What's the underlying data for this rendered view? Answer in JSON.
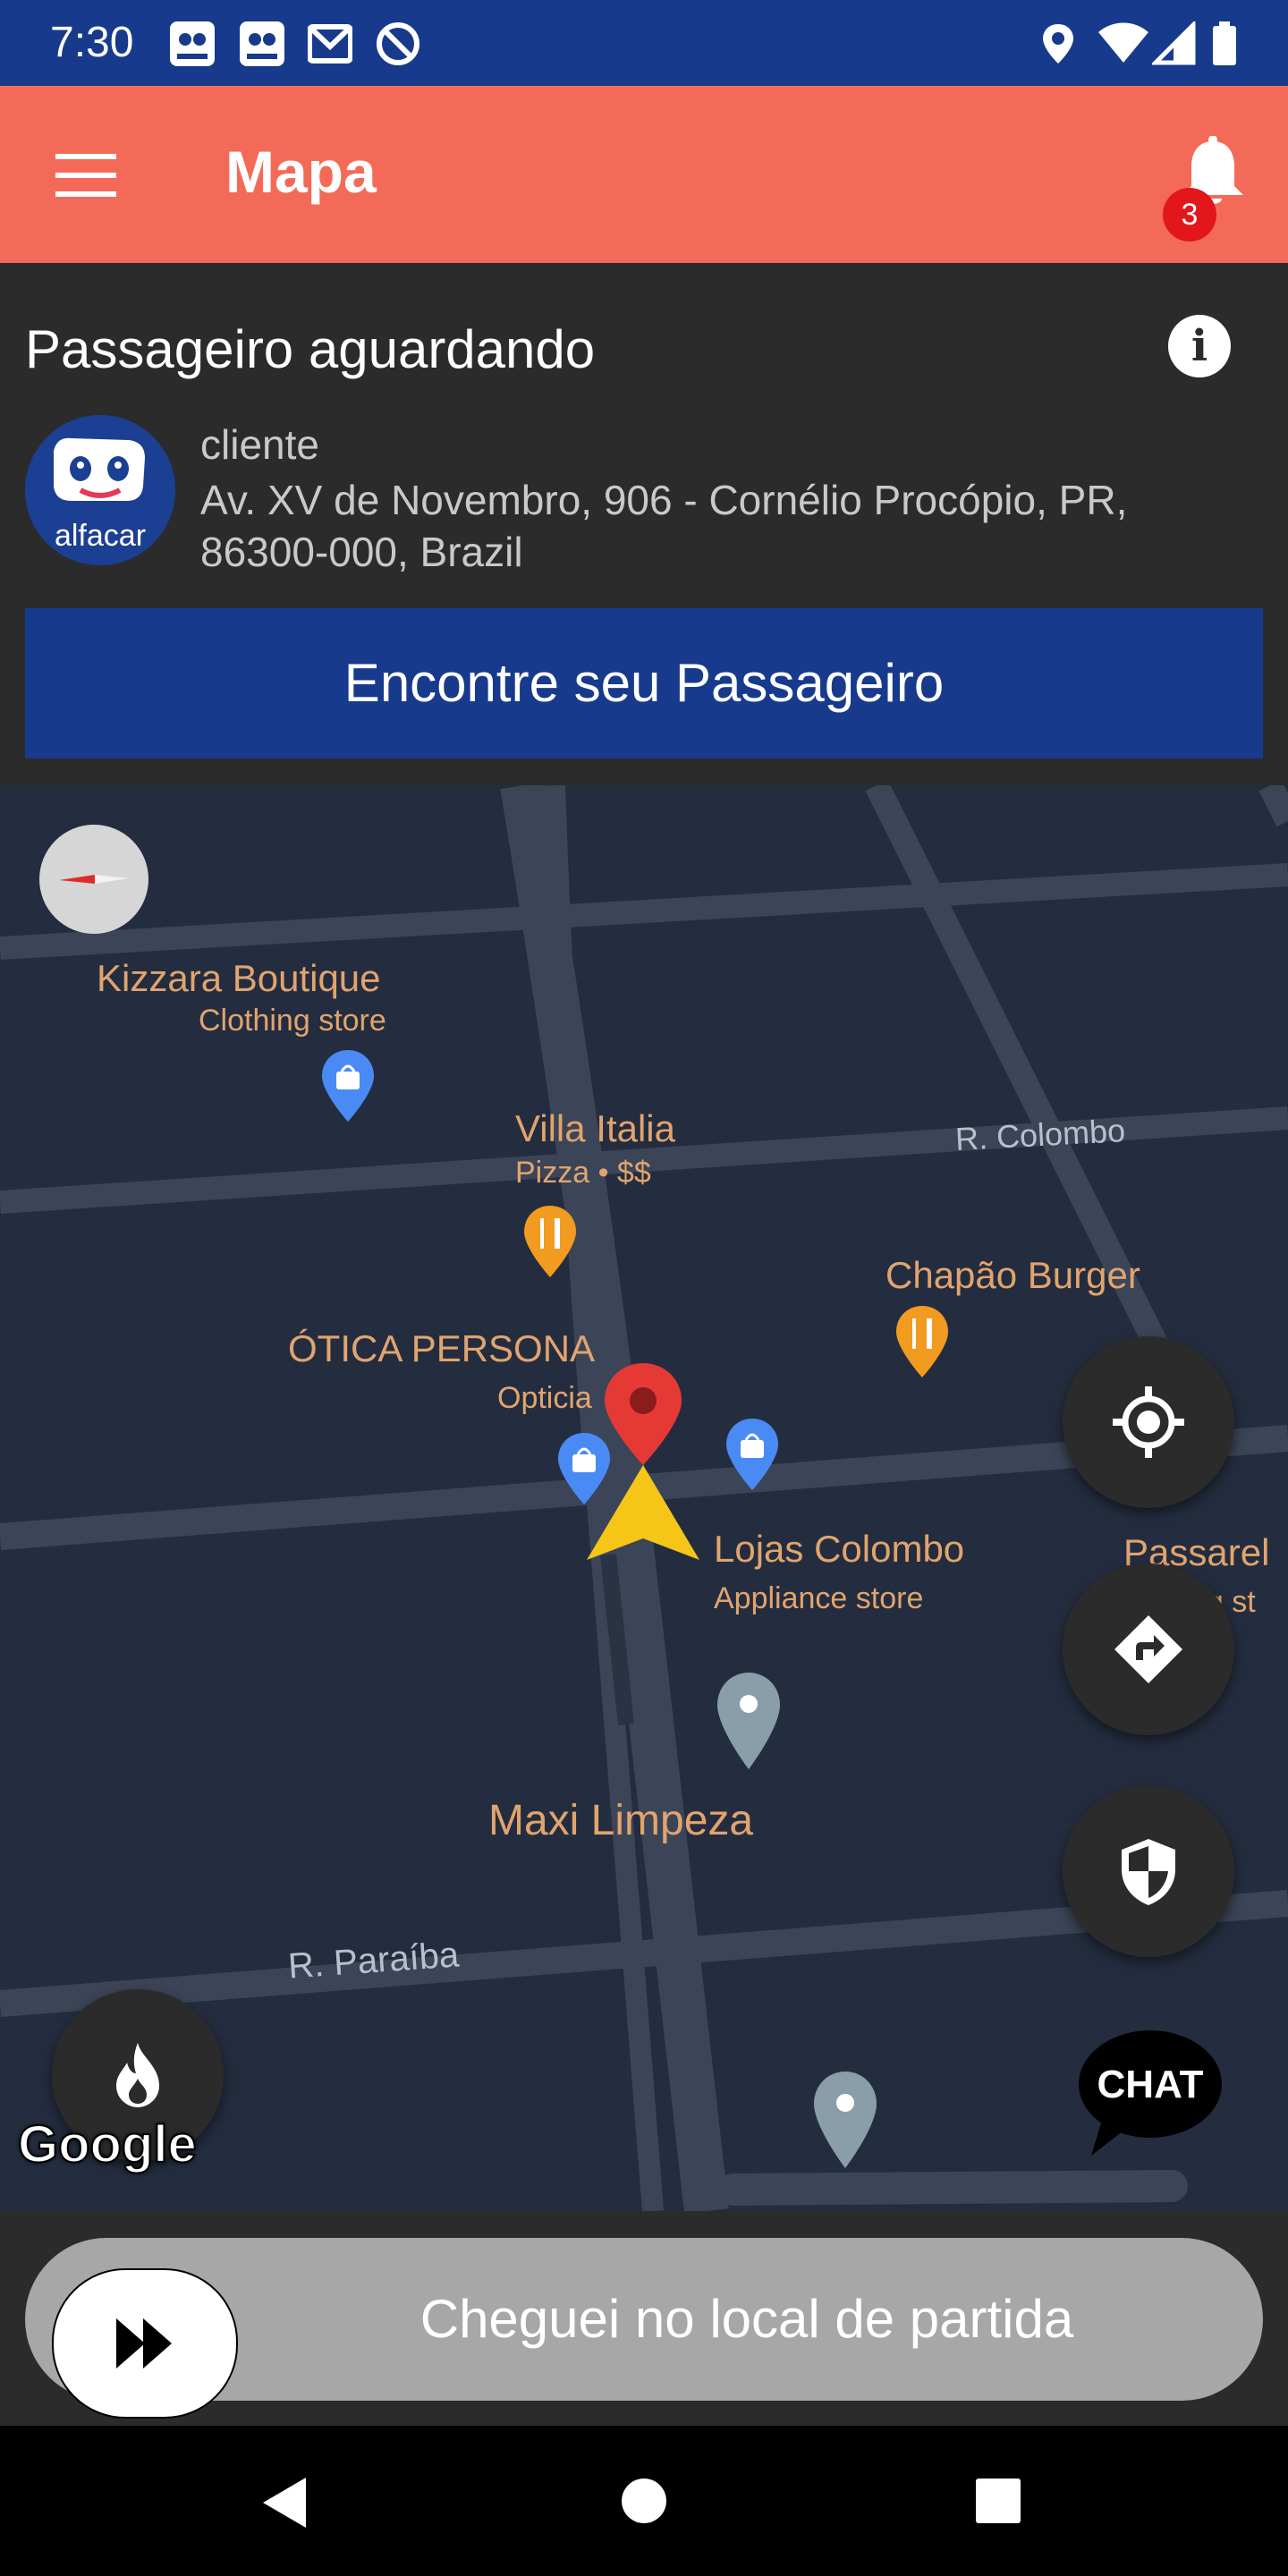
{
  "status_bar": {
    "time": "7:30",
    "icons": [
      "alfacar-notification-icon",
      "alfacar-notification-icon",
      "gmail-icon",
      "do-not-disturb-icon",
      "location-icon",
      "wifi-icon",
      "signal-icon",
      "battery-icon"
    ],
    "notif_label": "alfacar"
  },
  "app_bar": {
    "title": "Mapa",
    "notification_count": "3"
  },
  "passenger_panel": {
    "heading": "Passageiro aguardando",
    "info_icon": "i",
    "client_name": "cliente",
    "address": "Av. XV de Novembro, 906 - Cornélio Procópio, PR, 86300-000, Brazil",
    "avatar_text": "alfacar",
    "find_button": "Encontre seu Passageiro"
  },
  "map": {
    "places": [
      {
        "name": "Kizzara Boutique",
        "category": "Clothing store"
      },
      {
        "name": "Villa Italia",
        "category": "Pizza • $$"
      },
      {
        "name": "Chapão Burger",
        "category": ""
      },
      {
        "name": "ÓTICA PERSONA",
        "category": "Opticia"
      },
      {
        "name": "Lojas Colombo",
        "category": "Appliance store"
      },
      {
        "name": "Passarel",
        "category": "ng st"
      },
      {
        "name": "Maxi Limpeza",
        "category": ""
      }
    ],
    "streets": [
      "R. Colombo",
      "R. Paraíba"
    ],
    "attribution": "Google",
    "chat_label": "CHAT",
    "colors": {
      "background": "#242d3f",
      "road": "#3b4557",
      "place_label": "#e1a46e",
      "route_marker": "#f5c518"
    }
  },
  "swipe": {
    "label": "Cheguei no local de partida"
  },
  "nav_bar": {
    "buttons": [
      "back",
      "home",
      "recents"
    ]
  }
}
